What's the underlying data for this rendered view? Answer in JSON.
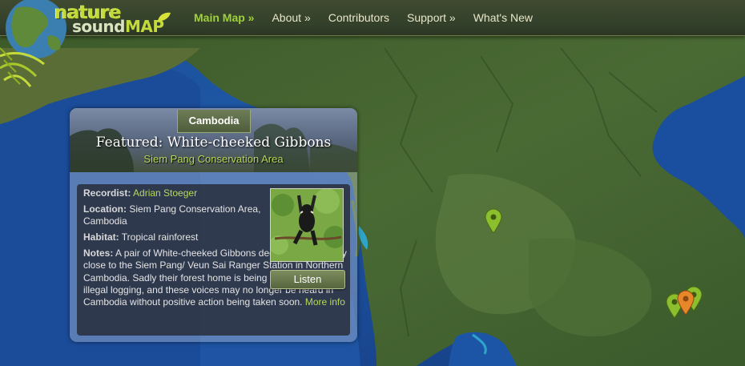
{
  "brand": {
    "line1": "nature",
    "line2_a": "sound",
    "line2_b": "MAP"
  },
  "nav": {
    "items": [
      {
        "label": "Main Map »",
        "active": true
      },
      {
        "label": "About »",
        "active": false
      },
      {
        "label": "Contributors",
        "active": false
      },
      {
        "label": "Support »",
        "active": false
      },
      {
        "label": "What's New",
        "active": false
      }
    ]
  },
  "panel": {
    "country": "Cambodia",
    "title": "Featured: White-cheeked Gibbons",
    "subtitle": "Siem Pang Conservation Area",
    "recordist_label": "Recordist:",
    "recordist": "Adrian Stoeger",
    "location_label": "Location:",
    "location": "Siem Pang Conservation Area, Cambodia",
    "habitat_label": "Habitat:",
    "habitat": "Tropical rainforest",
    "notes_label": "Notes:",
    "notes": "A pair of White-cheeked Gibbons declare their territory close to the Siem Pang/ Veun Sai Ranger Station in Northern Cambodia. Sadly their forest home is being torn down by illegal logging, and these voices may no longer be heard in Cambodia without positive action being taken soon.",
    "more_info": "More info",
    "listen": "Listen"
  },
  "colors": {
    "accent": "#9fd13a",
    "pin_green": "#8cbf2e",
    "pin_orange": "#e8862a"
  },
  "icons": [
    "map-pin-icon",
    "gibbon-photo",
    "globe-logo-icon"
  ]
}
